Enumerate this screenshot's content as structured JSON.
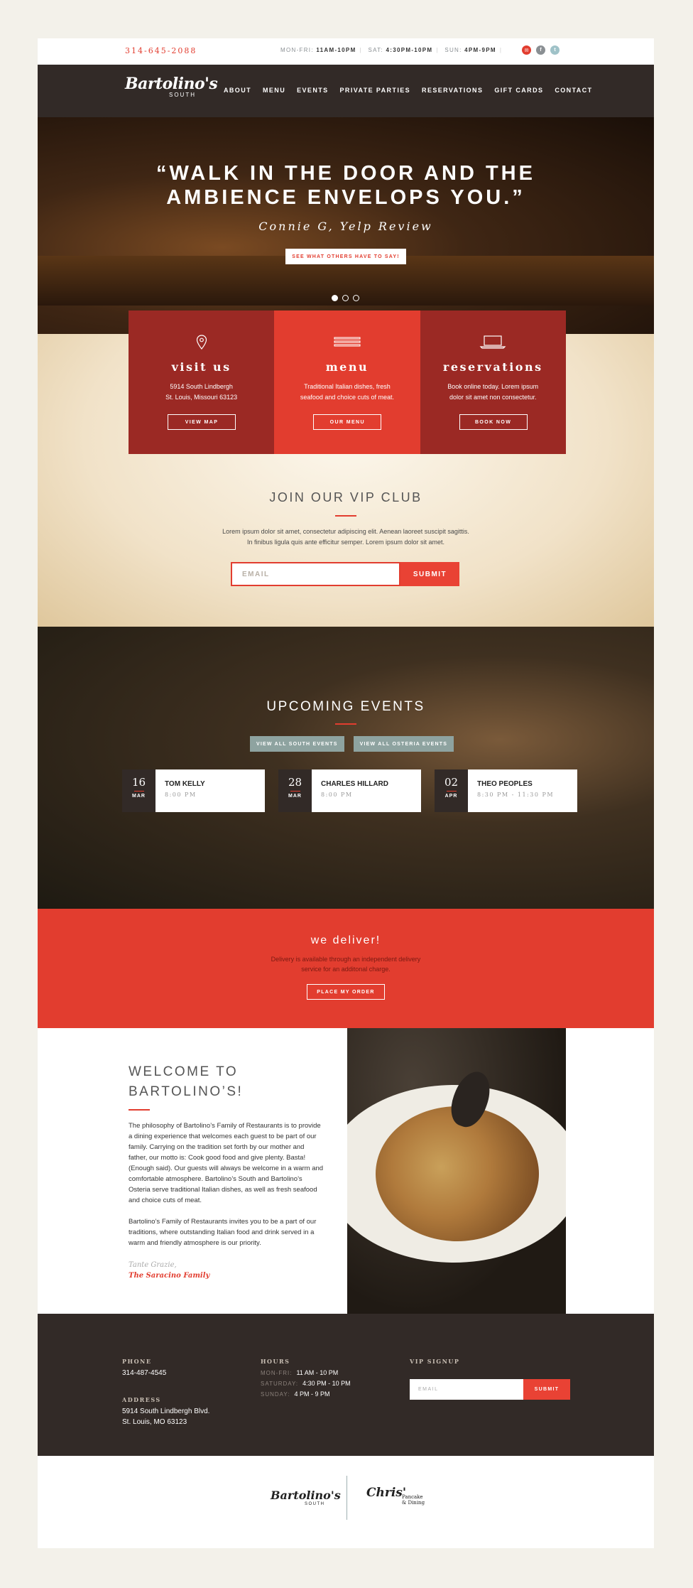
{
  "topbar": {
    "phone": "314-645-2088",
    "hours": [
      {
        "label": "MON-FRI:",
        "value": "11AM-10PM"
      },
      {
        "label": "SAT:",
        "value": "4:30PM-10PM"
      },
      {
        "label": "SUN:",
        "value": "4PM-9PM"
      }
    ],
    "social": [
      "mail-icon",
      "facebook-icon",
      "twitter-icon"
    ]
  },
  "nav": {
    "logo_script": "Bartolino's",
    "logo_sub": "SOUTH",
    "links": [
      "ABOUT",
      "MENU",
      "EVENTS",
      "PRIVATE PARTIES",
      "RESERVATIONS",
      "GIFT CARDS",
      "CONTACT"
    ]
  },
  "hero": {
    "quote_line1": "“WALK IN THE DOOR AND THE",
    "quote_line2": "AMBIENCE ENVELOPS YOU.”",
    "cite": "Connie G, Yelp Review",
    "button": "SEE WHAT OTHERS HAVE TO SAY!",
    "slides": 3,
    "active_slide": 1
  },
  "features": [
    {
      "title": "visit us",
      "line1": "5914 South Lindbergh",
      "line2": "St. Louis, Missouri 63123",
      "button": "VIEW MAP",
      "icon": "map-pin-icon",
      "color": "#9b2924"
    },
    {
      "title": "menu",
      "line1": "Traditional Italian dishes, fresh",
      "line2": "seafood and choice cuts of meat.",
      "button": "OUR MENU",
      "icon": "fork-knife-icon",
      "color": "#e23d2f"
    },
    {
      "title": "reservations",
      "line1": "Book online today. Lorem ipsum",
      "line2": "dolor sit amet non consectetur.",
      "button": "BOOK NOW",
      "icon": "laptop-icon",
      "color": "#9b2924"
    }
  ],
  "vip": {
    "title": "JOIN OUR VIP CLUB",
    "line1": "Lorem ipsum dolor sit amet, consectetur adipiscing elit. Aenean laoreet suscipit sagittis.",
    "line2": "In finibus ligula quis ante efficitur semper. Lorem ipsum dolor sit amet.",
    "placeholder": "EMAIL",
    "submit": "SUBMIT"
  },
  "events": {
    "title": "UPCOMING EVENTS",
    "btn_south": "VIEW ALL SOUTH EVENTS",
    "btn_osteria": "VIEW ALL OSTERIA EVENTS",
    "items": [
      {
        "day": "16",
        "month": "MAR",
        "name": "TOM KELLY",
        "time": "8:00 PM"
      },
      {
        "day": "28",
        "month": "MAR",
        "name": "CHARLES HILLARD",
        "time": "8:00 PM"
      },
      {
        "day": "02",
        "month": "APR",
        "name": "THEO PEOPLES",
        "time": "8:30 PM - 11:30 PM"
      }
    ]
  },
  "deliver": {
    "title": "we deliver!",
    "line1": "Delivery is available through an independent delivery",
    "line2": "service for an additonal charge.",
    "button": "PLACE MY ORDER"
  },
  "welcome": {
    "title1": "WELCOME TO",
    "title2": "BARTOLINO’S!",
    "p1": "The philosophy of Bartolino’s Family of Restaurants is to provide a dining experience that welcomes each guest to be part of our family. Carrying on the tradition set forth by our mother and father, our motto is: Cook good food and give plenty. Basta! (Enough said). Our guests will always be welcome in a warm and comfortable atmosphere. Bartolino’s South and Bartolino’s Osteria serve traditional Italian dishes, as well as fresh seafood and choice cuts of meat.",
    "p2": "Bartolino’s Family of Restaurants invites you to be a part of our traditions, where outstanding Italian food and drink served in a warm and friendly atmosphere is our priority.",
    "sig1": "Tante Grazie,",
    "sig2": "The Saracino Family"
  },
  "footer": {
    "phone_label": "PHONE",
    "phone": "314-487-4545",
    "address_label": "ADDRESS",
    "address1": "5914 South Lindbergh Blvd.",
    "address2": "St. Louis, MO 63123",
    "hours_label": "HOURS",
    "hours": [
      {
        "day": "MON-FRI:",
        "time": "11 AM - 10 PM"
      },
      {
        "day": "SATURDAY:",
        "time": "4:30 PM - 10 PM"
      },
      {
        "day": "SUNDAY:",
        "time": "4 PM - 9 PM"
      }
    ],
    "signup_label": "VIP SIGNUP",
    "placeholder": "EMAIL",
    "submit": "SUBMIT"
  },
  "brands": {
    "b1_script": "Bartolino's",
    "b1_sub": "SOUTH",
    "b2_script": "Chris'",
    "b2_l1": "Pancake",
    "b2_l2": "& Dining"
  }
}
